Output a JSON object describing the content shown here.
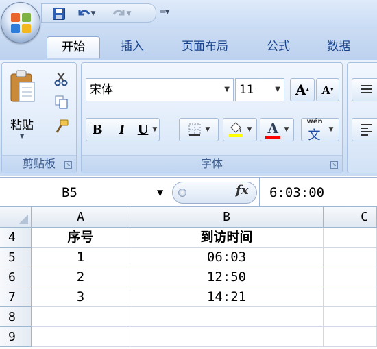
{
  "qat": {
    "icons": [
      "save-icon",
      "undo-icon",
      "redo-icon",
      "customize-qat-icon"
    ]
  },
  "tabs": [
    "开始",
    "插入",
    "页面布局",
    "公式",
    "数据"
  ],
  "clipboard": {
    "paste_label": "粘贴",
    "group_label": "剪贴板"
  },
  "font": {
    "name": "宋体",
    "size": "11",
    "grow_label": "A",
    "shrink_label": "A",
    "bold_label": "B",
    "italic_label": "I",
    "underline_label": "U",
    "color_label": "A",
    "phonetic_top": "wén",
    "phonetic_bottom": "文",
    "group_label": "字体",
    "highlight_color": "#ffff00",
    "font_color": "#ff0000"
  },
  "formula_bar": {
    "name_box": "B5",
    "fx_label": "fx",
    "value": "6:03:00"
  },
  "sheet": {
    "columns": [
      "A",
      "B",
      "C"
    ],
    "rows": [
      {
        "num": "4",
        "a": "序号",
        "b": "到访时间"
      },
      {
        "num": "5",
        "a": "1",
        "b": "06:03"
      },
      {
        "num": "6",
        "a": "2",
        "b": "12:50"
      },
      {
        "num": "7",
        "a": "3",
        "b": "14:21"
      },
      {
        "num": "8",
        "a": "",
        "b": ""
      },
      {
        "num": "9",
        "a": "",
        "b": ""
      }
    ]
  }
}
